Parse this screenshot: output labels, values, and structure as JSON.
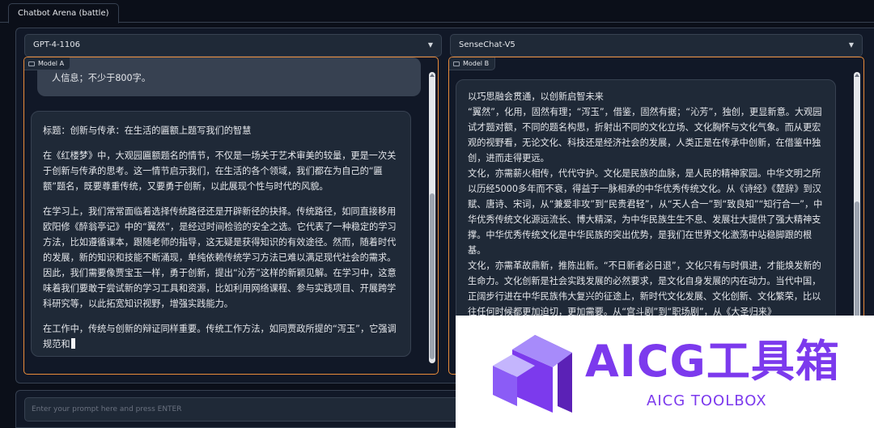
{
  "app": {
    "tab_label": "Chatbot Arena (battle)"
  },
  "model_a": {
    "selector_value": "GPT-4-1106",
    "label": "Model A",
    "user_message_tail": "人信息；不少于800字。",
    "response_paragraphs": [
      "标题：创新与传承：在生活的匾额上题写我们的智慧",
      "在《红楼梦》中，大观园匾额题名的情节，不仅是一场关于艺术审美的较量，更是一次关于创新与传承的思考。这一情节启示我们，在生活的各个领域，我们都在为自己的“匾额”题名，既要尊重传统，又要勇于创新，以此展现个性与时代的风貌。",
      "在学习上，我们常常面临着选择传统路径还是开辟新径的抉择。传统路径，如同直接移用欧阳修《醉翁亭记》中的“翼然”，是经过时间检验的安全之选。它代表了一种稳定的学习方法，比如遵循课本，跟随老师的指导，这无疑是获得知识的有效途径。然而，随着时代的发展，新的知识和技能不断涌现，单纯依赖传统学习方法已难以满足现代社会的需求。因此，我们需要像贾宝玉一样，勇于创新，提出“沁芳”这样的新颖见解。在学习中，这意味着我们要敢于尝试新的学习工具和资源，比如利用网络课程、参与实践项目、开展跨学科研究等，以此拓宽知识视野，增强实践能力。",
      "在工作中，传统与创新的辩证同样重要。传统工作方法，如同贾政所提的“泻玉”，它强调规范和"
    ]
  },
  "model_b": {
    "selector_value": "SenseChat-V5",
    "label": "Model B",
    "response_lines": [
      "以巧思融会贯通，以创新启智未来",
      "“翼然”，化用，固然有理；“泻玉”，借鉴，固然有据；“沁芳”，独创，更显新意。大观园试才题对额，不同的题名构思，折射出不同的文化立场、文化胸怀与文化气象。而从更宏观的视野看，无论文化、科技还是经济社会的发展，人类正是在传承中创新，在借鉴中独创，进而走得更远。",
      "文化，亦需薪火相传，代代守护。文化是民族的血脉，是人民的精神家园。中华文明之所以历经5000多年而不衰，得益于一脉相承的中华优秀传统文化。从《诗经》《楚辞》到汉赋、唐诗、宋词，从“兼爱非攻”到“民贵君轻”，从“天人合一”到“致良知”“知行合一”，中华优秀传统文化源远流长、博大精深，为中华民族生生不息、发展壮大提供了强大精神支撑。中华优秀传统文化是中华民族的突出优势，是我们在世界文化激荡中站稳脚跟的根基。",
      "文化，亦需革故鼎新，推陈出新。“不日新者必日退”，文化只有与时俱进，才能焕发新的生命力。文化创新是社会实践发展的必然要求，是文化自身发展的内在动力。当代中国，正阔步行进在中华民族伟大复兴的征途上，新时代文化发展、文化创新、文化繁荣，比以往任何时候都更加迫切，更加需要。从“宫斗剧”到“职场剧”，从《大圣归来》"
    ]
  },
  "prompt": {
    "placeholder": "Enter your prompt here and press ENTER"
  },
  "watermark": {
    "title": "AICG工具箱",
    "subtitle": "AICG TOOLBOX"
  },
  "colors": {
    "accent_border": "#ea8c3a",
    "brand_purple": "#7c3aed"
  }
}
